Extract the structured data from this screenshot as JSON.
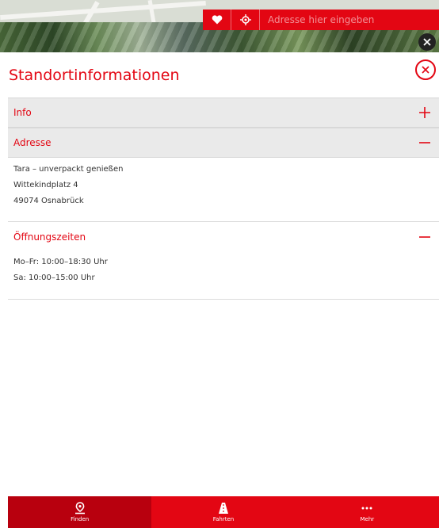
{
  "search": {
    "placeholder": "Adresse hier eingeben"
  },
  "panel": {
    "title": "Standortinformationen",
    "sections": {
      "info": {
        "label": "Info"
      },
      "address": {
        "label": "Adresse",
        "lines": [
          "Tara – unverpackt genießen",
          "Wittekindplatz 4",
          "49074 Osnabrück"
        ]
      },
      "hours": {
        "label": "Öffnungszeiten",
        "lines": [
          "Mo–Fr: 10:00–18:30 Uhr",
          "Sa: 10:00–15:00 Uhr"
        ]
      }
    }
  },
  "nav": {
    "items": [
      {
        "label": "Finden",
        "icon": "map-pin-icon"
      },
      {
        "label": "Fahrten",
        "icon": "road-icon"
      },
      {
        "label": "Mehr",
        "icon": "more-dots-icon"
      }
    ]
  },
  "colors": {
    "accent": "#e30613",
    "accent_dark": "#b8000e",
    "section_bg": "#eaeaea"
  }
}
